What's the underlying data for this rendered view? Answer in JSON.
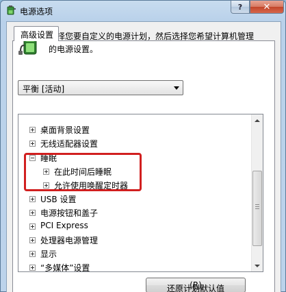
{
  "window": {
    "title": "电源选项",
    "help_label": "?",
    "close_label": "✕"
  },
  "tab": {
    "label": "高级设置"
  },
  "description": "选择您要自定义的电源计划，然后选择您希望计算机管理的电源设置。",
  "plan_select": {
    "value": "平衡 [活动]"
  },
  "tree": {
    "items": [
      {
        "label": "桌面背景设置",
        "level": 0,
        "expanded": false
      },
      {
        "label": "无线适配器设置",
        "level": 0,
        "expanded": false
      },
      {
        "label": "睡眠",
        "level": 0,
        "expanded": true
      },
      {
        "label": "在此时间后睡眠",
        "level": 1,
        "expanded": false
      },
      {
        "label": "允许使用唤醒定时器",
        "level": 1,
        "expanded": false
      },
      {
        "label": "USB 设置",
        "level": 0,
        "expanded": false
      },
      {
        "label": "电源按钮和盖子",
        "level": 0,
        "expanded": false
      },
      {
        "label": "PCI Express",
        "level": 0,
        "expanded": false
      },
      {
        "label": "处理器电源管理",
        "level": 0,
        "expanded": false
      },
      {
        "label": "显示",
        "level": 0,
        "expanded": false
      },
      {
        "label": "“多媒体”设置",
        "level": 0,
        "expanded": false
      }
    ]
  },
  "restore_button": {
    "label": "还原计划默认值",
    "shortcut": "(R)"
  },
  "colors": {
    "highlight": "#d11f1f",
    "title_bar": "#b9d1ea",
    "close_button": "#c2462a"
  },
  "icons": {
    "app": "power-options-icon",
    "battery": "battery-plug-icon"
  }
}
